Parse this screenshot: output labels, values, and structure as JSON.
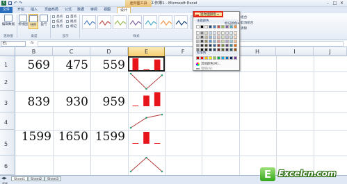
{
  "window": {
    "title": "工作簿1 - Microsoft Excel",
    "context_tab_header": "迷你图工具",
    "controls": [
      "–",
      "□",
      "✕"
    ]
  },
  "tabs": [
    {
      "label": "文件"
    },
    {
      "label": "开始"
    },
    {
      "label": "插入"
    },
    {
      "label": "页面布局"
    },
    {
      "label": "公式"
    },
    {
      "label": "数据"
    },
    {
      "label": "审阅"
    },
    {
      "label": "视图"
    },
    {
      "label": "设计"
    }
  ],
  "ribbon": {
    "edit_data": "编辑数据",
    "line": "折线图",
    "column": "柱形",
    "winloss": "盈亏",
    "checks": [
      "高点",
      "低点",
      "负点",
      "首点",
      "尾点",
      "标记"
    ],
    "group_labels": [
      "迷你图",
      "类型",
      "显示",
      "样式"
    ],
    "marker_color": "标记颜色",
    "axis": "坐标轴",
    "group": "组合",
    "ungroup": "取消组合",
    "clear": "清除"
  },
  "formula_bar": {
    "name_box": "E1",
    "fx": "fx"
  },
  "columns": [
    "B",
    "C",
    "D",
    "E",
    "F",
    "G",
    "H",
    "I",
    "J"
  ],
  "rows": [
    "1",
    "2",
    "3",
    "4",
    "5",
    "6"
  ],
  "cells": {
    "r1": [
      "569",
      "475",
      "559"
    ],
    "r3": [
      "839",
      "930",
      "959"
    ],
    "r5": [
      "1599",
      "1650",
      "1599"
    ]
  },
  "sparklines": {
    "row1_column": [
      569,
      475,
      559
    ],
    "row2_line": [
      569,
      475,
      559
    ],
    "row3_column": [
      839,
      930,
      959
    ],
    "row4_line": [
      839,
      930,
      959
    ],
    "row5_column": [
      1599,
      1650,
      1599
    ],
    "row6_line": [
      1599,
      1650,
      1599
    ],
    "bar_color": "#e8141b",
    "line_color": "#b03030",
    "marker_color": "#2aa37a"
  },
  "dropdown": {
    "button_label": "迷你图颜色",
    "theme_colors_label": "主题颜色",
    "standard_colors_label": "标准色",
    "more_colors": "其他颜色(M)...",
    "weight": "粗细(W)",
    "theme_colors": [
      [
        "#ffffff",
        "#000000",
        "#eeece1",
        "#1f497d",
        "#4f81bd",
        "#c0504d",
        "#9bbb59",
        "#8064a2",
        "#4bacc6",
        "#f79646"
      ],
      [
        "#f2f2f2",
        "#7f7f7f",
        "#ddd9c3",
        "#c6d9f0",
        "#dbe5f1",
        "#f2dcdb",
        "#ebf1dd",
        "#e5e0ec",
        "#dbeef3",
        "#fdeada"
      ],
      [
        "#d8d8d8",
        "#595959",
        "#c4bd97",
        "#8db3e2",
        "#b8cce4",
        "#e5b9b7",
        "#d7e3bc",
        "#ccc1d9",
        "#b7dde8",
        "#fbd5b5"
      ],
      [
        "#bfbfbf",
        "#3f3f3f",
        "#938953",
        "#548dd4",
        "#95b3d7",
        "#d99694",
        "#c3d69b",
        "#b2a2c7",
        "#92cddc",
        "#fac08f"
      ],
      [
        "#a5a5a5",
        "#262626",
        "#494429",
        "#17365d",
        "#366092",
        "#953734",
        "#76923c",
        "#5f497a",
        "#31859b",
        "#e36c09"
      ],
      [
        "#7f7f7f",
        "#0c0c0c",
        "#1d1b10",
        "#0f243e",
        "#244061",
        "#632423",
        "#4f6128",
        "#3f3151",
        "#205867",
        "#974806"
      ]
    ],
    "standard_colors": [
      "#c00000",
      "#ff0000",
      "#ffc000",
      "#ffff00",
      "#92d050",
      "#00b050",
      "#00b0f0",
      "#0070c0",
      "#002060",
      "#7030a0"
    ]
  },
  "sheets": [
    "Sheet1",
    "Sheet2",
    "Sheet3"
  ],
  "status": "就绪",
  "watermark": {
    "letter": "E",
    "text": "Excelcn.com"
  }
}
